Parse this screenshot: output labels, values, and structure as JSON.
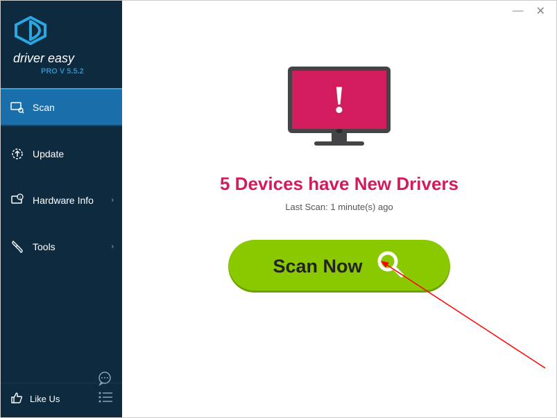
{
  "brand": {
    "title": "driver easy",
    "version": "PRO V 5.5.2"
  },
  "sidebar": {
    "items": [
      {
        "label": "Scan",
        "has_chevron": false
      },
      {
        "label": "Update",
        "has_chevron": false
      },
      {
        "label": "Hardware Info",
        "has_chevron": true
      },
      {
        "label": "Tools",
        "has_chevron": true
      }
    ],
    "like_label": "Like Us"
  },
  "main": {
    "headline": "5 Devices have New Drivers",
    "last_scan": "Last Scan: 1 minute(s) ago",
    "scan_button": "Scan Now"
  },
  "colors": {
    "sidebar_bg": "#0e2a3f",
    "accent_blue": "#1a6faa",
    "alert_pink": "#d21c5d",
    "scan_green": "#8ac900"
  }
}
